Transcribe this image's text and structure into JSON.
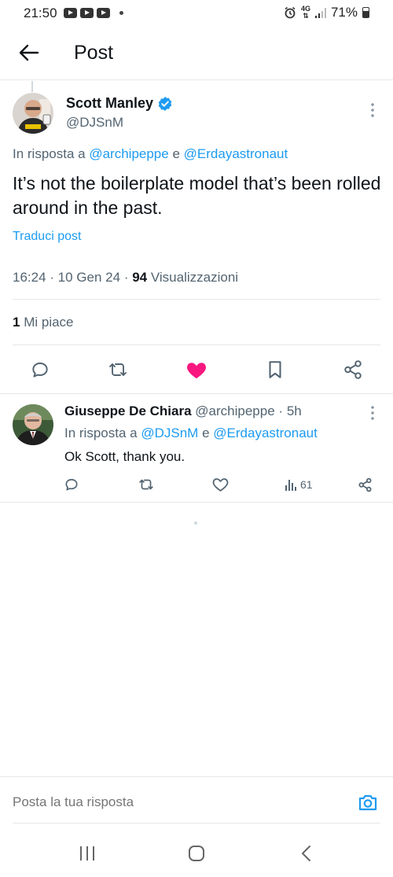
{
  "status_bar": {
    "time": "21:50",
    "network": "4G",
    "battery": "71%"
  },
  "header": {
    "title": "Post"
  },
  "main_post": {
    "author_name": "Scott Manley",
    "author_handle": "@DJSnM",
    "verified": true,
    "reply_prefix": "In risposta a",
    "reply_user_1": "@archipeppe",
    "reply_conjunction": "e",
    "reply_user_2": "@Erdayastronaut",
    "text": "It’s not the boilerplate model that’s been rolled around in the past.",
    "translate_label": "Traduci post",
    "time": "16:24",
    "date": "10 Gen 24",
    "views_count": "94",
    "views_label": "Visualizzazioni",
    "likes_count": "1",
    "likes_label": "Mi piace",
    "liked": true
  },
  "reply_post": {
    "author_name": "Giuseppe De Chiara",
    "author_handle": "@archipeppe",
    "age": "5h",
    "reply_prefix": "In risposta a",
    "reply_user_1": "@DJSnM",
    "reply_conjunction": "e",
    "reply_user_2": "@Erdayastronaut",
    "text": "Ok Scott, thank you.",
    "views_count": "61"
  },
  "composer": {
    "placeholder": "Posta la tua risposta"
  },
  "colors": {
    "link": "#1d9bf0",
    "like": "#f91880",
    "muted": "#536471",
    "verified": "#1d9bf0"
  },
  "icons": {
    "back": "arrow-left-icon",
    "more": "more-vertical-icon",
    "reply": "comment-icon",
    "retweet": "repost-icon",
    "like": "heart-icon",
    "bookmark": "bookmark-icon",
    "share": "share-icon",
    "views": "views-bar-icon",
    "camera": "camera-icon"
  }
}
